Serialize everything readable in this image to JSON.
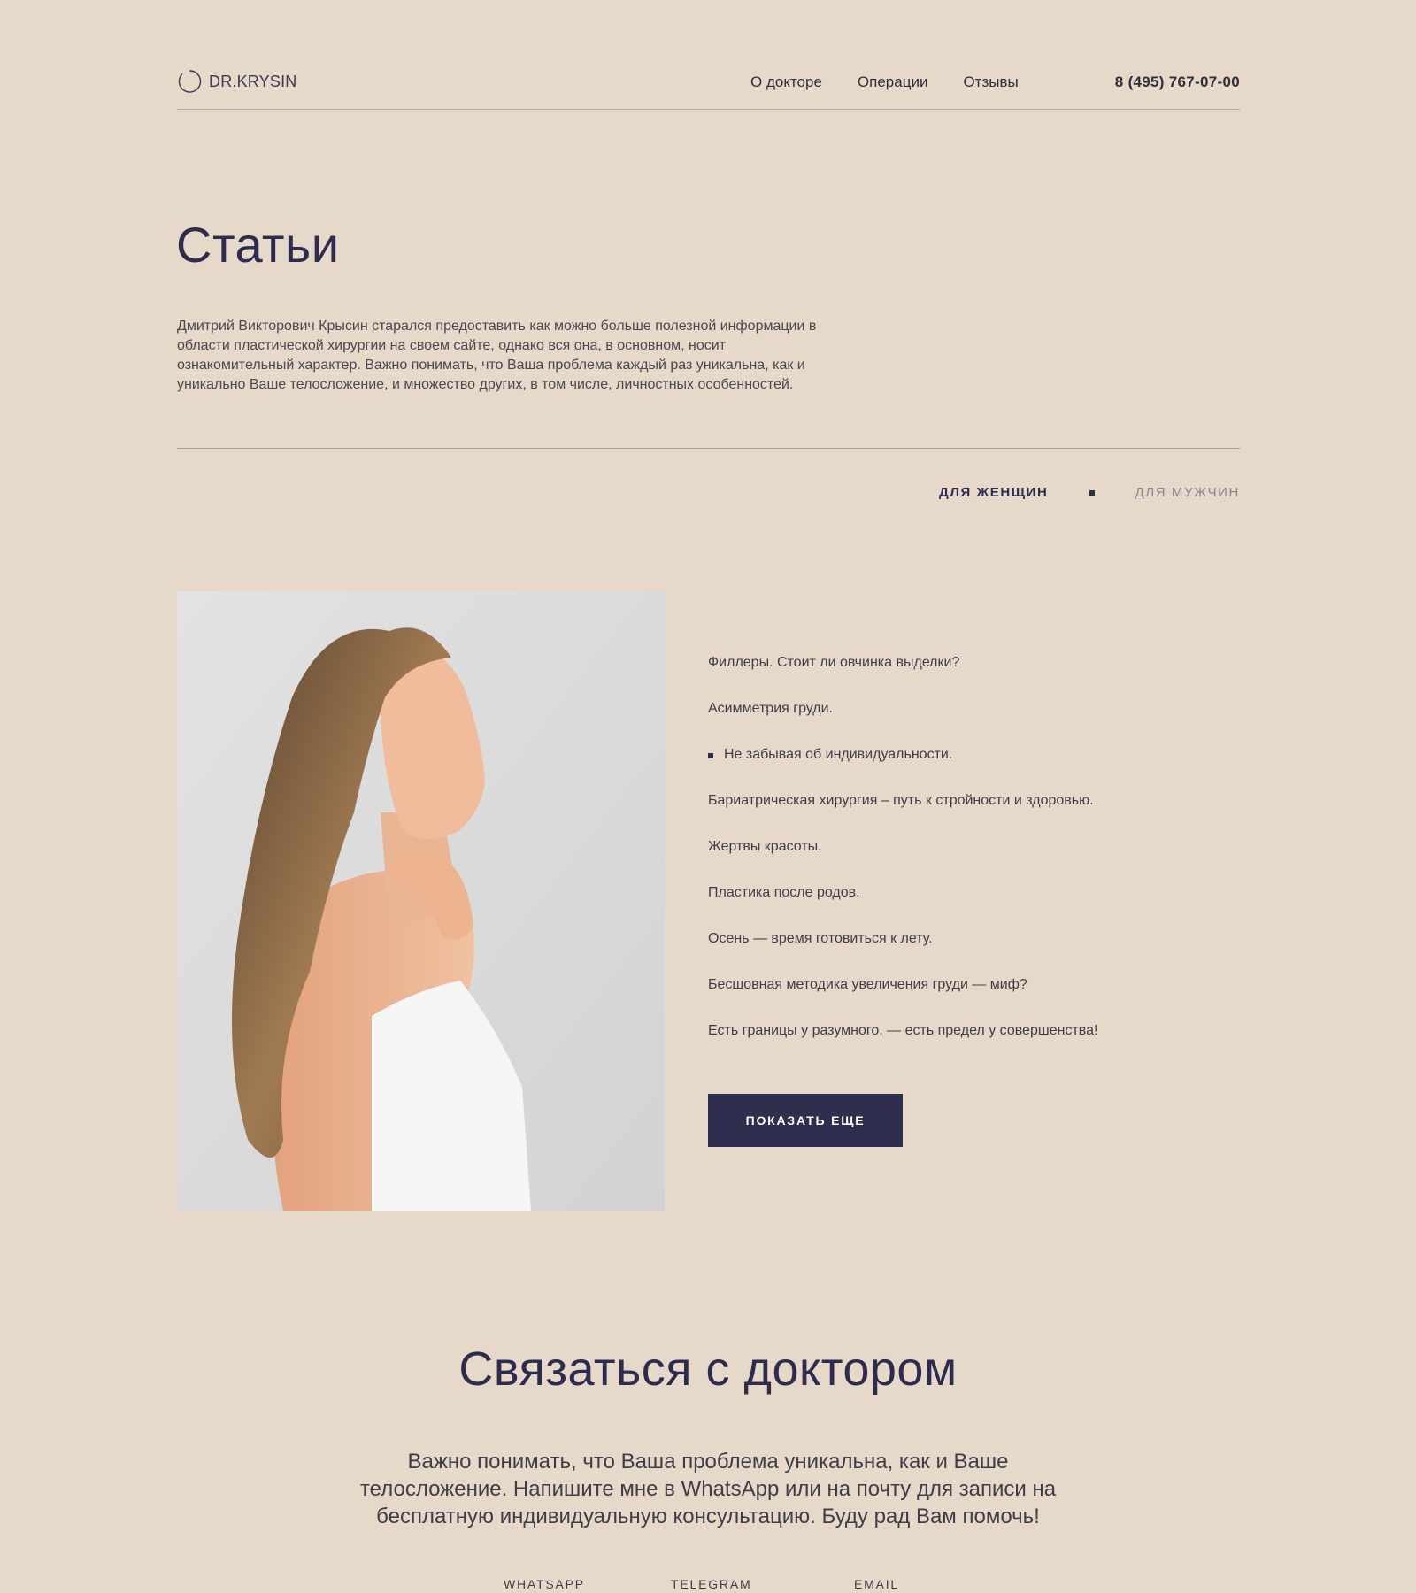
{
  "header": {
    "logo_text": "DR.KRYSIN",
    "nav": [
      "О докторе",
      "Операции",
      "Отзывы"
    ],
    "phone": "8 (495) 767-07-00"
  },
  "page": {
    "title": "Статьи",
    "intro": "Дмитрий Викторович Крысин старался предоставить как можно больше полезной информации в области пластической хирургии на своем сайте, однако вся она, в основном, носит ознакомительный характер. Важно понимать, что Ваша проблема каждый раз уникальна, как и уникально Ваше телосложение, и множество других, в том числе, личностных особенностей."
  },
  "filters": {
    "women": "ДЛЯ ЖЕНЩИН",
    "men": "ДЛЯ МУЖЧИН"
  },
  "articles": [
    "Филлеры. Стоит ли овчинка выделки?",
    "Асимметрия груди.",
    "Не забывая об индивидуальности.",
    "Бариатрическая хирургия – путь к стройности и здоровью.",
    "Жертвы красоты.",
    "Пластика после родов.",
    "Осень — время готовиться к лету.",
    "Бесшовная методика увеличения груди — миф?",
    "Есть границы у разумного, — есть предел у совершенства!"
  ],
  "more_button": "ПОКАЗАТЬ ЕЩЕ",
  "contact": {
    "title": "Связаться с доктором",
    "text": "Важно понимать, что Ваша проблема уникальна, как и Ваше телосложение. Напишите мне в WhatsApp или на почту для записи на бесплатную индивидуальную консультацию. Буду рад Вам помочь!",
    "links": [
      "WHATSAPP",
      "TELEGRAM",
      "EMAIL"
    ]
  },
  "colors": {
    "background": "#e7d9c9",
    "accent": "#2e2e4e",
    "text": "#3f3d48"
  }
}
